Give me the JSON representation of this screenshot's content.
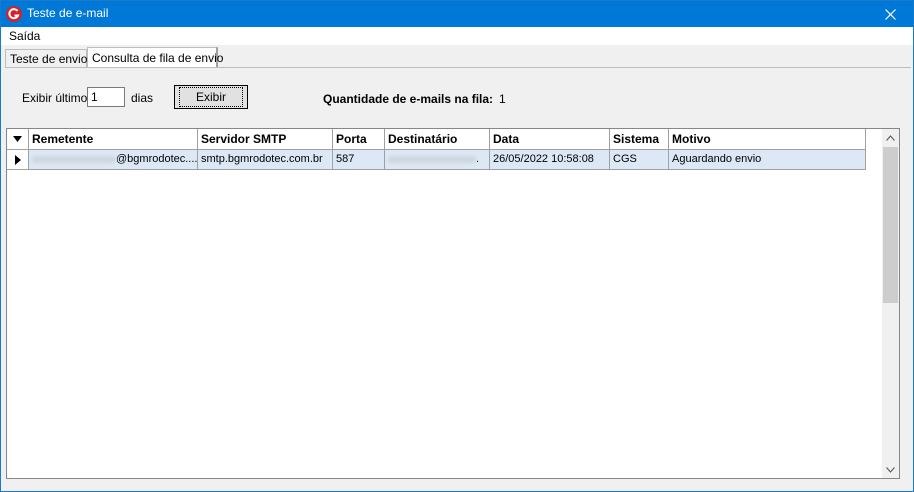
{
  "window": {
    "title": "Teste de e-mail"
  },
  "menu": {
    "items": [
      "Saída"
    ]
  },
  "tabs": [
    {
      "label": "Teste de envio",
      "active": false
    },
    {
      "label": "Consulta de fila de envio",
      "active": true
    }
  ],
  "filter": {
    "show_last_label": "Exibir últimos",
    "days_value": "1",
    "days_label": "dias",
    "button_label": "Exibir"
  },
  "queue": {
    "label": "Quantidade de e-mails na fila:",
    "count": "1"
  },
  "grid": {
    "columns": [
      "Remetente",
      "Servidor SMTP",
      "Porta",
      "Destinatário",
      "Data",
      "Sistema",
      "Motivo"
    ],
    "rows": [
      {
        "remetente": "@bgmrodotec....",
        "servidor": "smtp.bgmrodotec.com.br",
        "porta": "587",
        "destinatario": ".",
        "data": "26/05/2022 10:58:08",
        "sistema": "CGS",
        "motivo": "Aguardando envio"
      }
    ]
  },
  "colors": {
    "titlebar": "#0078d7",
    "selected_row": "#dce8f5",
    "app_icon": "#d2232a"
  },
  "icons": {
    "app": "app-logo-icon",
    "close": "close-icon",
    "row_pointer": "triangle-right-icon",
    "header_dropdown": "triangle-down-icon"
  }
}
